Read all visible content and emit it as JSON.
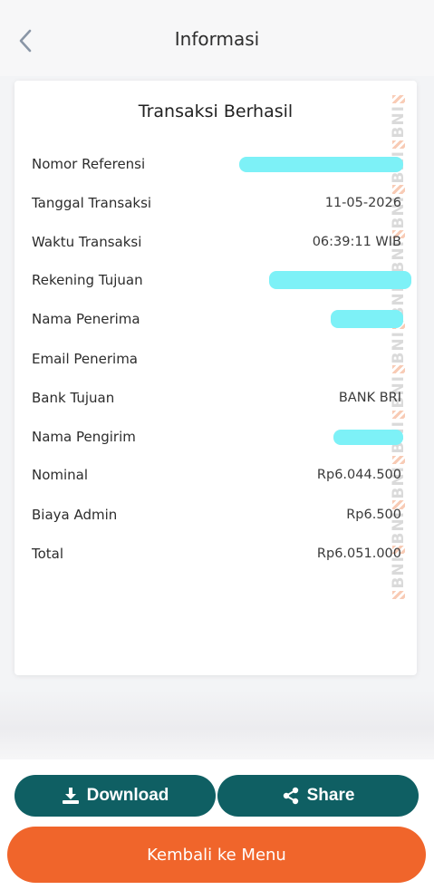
{
  "header": {
    "title": "Informasi",
    "back_icon": "chevron-left-icon"
  },
  "card": {
    "title": "Transaksi Berhasil",
    "watermark": "BNI",
    "rows": [
      {
        "label": "Nomor Referensi",
        "value": "",
        "masked": true
      },
      {
        "label": "Tanggal Transaksi",
        "value": "11-05-2026",
        "masked": false
      },
      {
        "label": "Waktu Transaksi",
        "value": "06:39:11 WIB",
        "masked": false
      },
      {
        "label": "Rekening Tujuan",
        "value": "",
        "masked": true
      },
      {
        "label": "Nama Penerima",
        "value": "",
        "masked": true
      },
      {
        "label": "Email Penerima",
        "value": "",
        "masked": false
      },
      {
        "label": "Bank Tujuan",
        "value": "BANK BRI",
        "masked": false
      },
      {
        "label": "Nama Pengirim",
        "value": "",
        "masked": true
      },
      {
        "label": "Nominal",
        "value": "Rp6.044.500",
        "masked": false
      },
      {
        "label": "Biaya Admin",
        "value": "Rp6.500",
        "masked": false
      },
      {
        "label": "Total",
        "value": "Rp6.051.000",
        "masked": false
      }
    ]
  },
  "actions": {
    "download_label": "Download",
    "download_icon": "download-icon",
    "share_label": "Share",
    "share_icon": "share-icon",
    "menu_label": "Kembali ke Menu"
  },
  "colors": {
    "primary_teal": "#0f5f63",
    "accent_orange": "#f0652b",
    "redaction_cyan": "#7df1f7"
  }
}
